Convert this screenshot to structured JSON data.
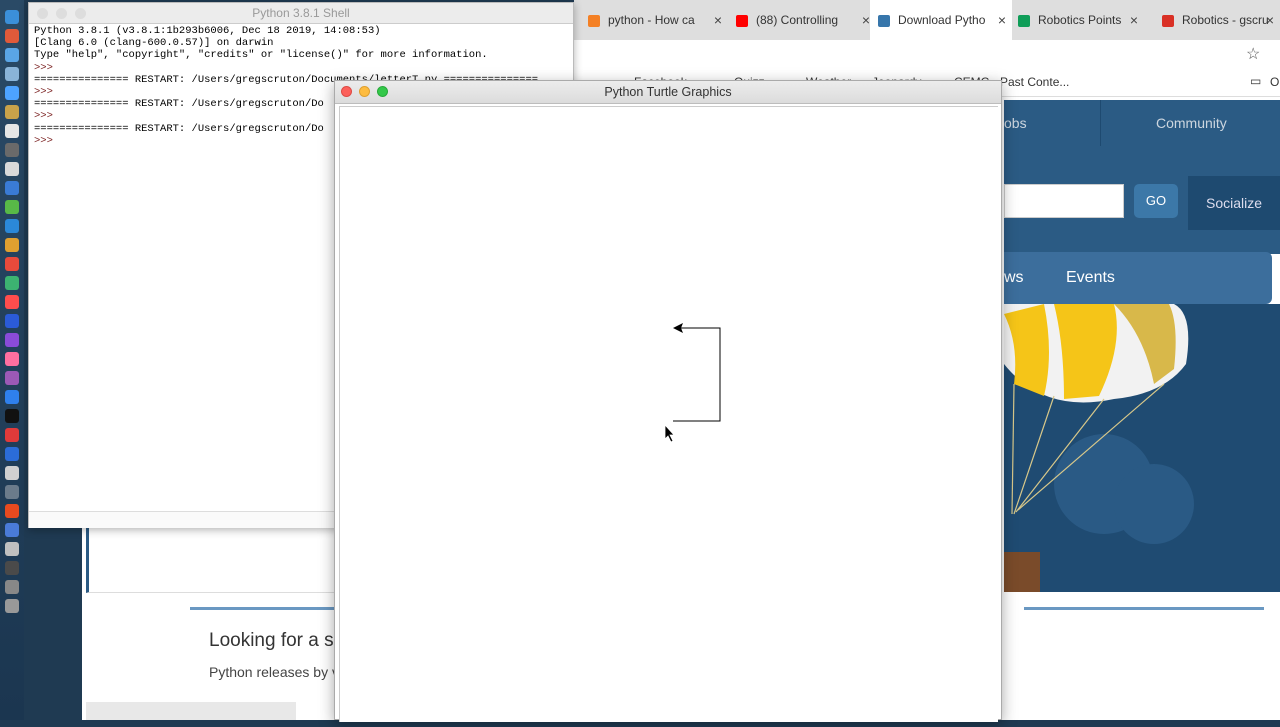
{
  "browser": {
    "tabs": [
      {
        "label": "python - How ca",
        "favicon_color": "#f48024"
      },
      {
        "label": "(88) Controlling",
        "favicon_color": "#ff0000"
      },
      {
        "label": "Download Pytho",
        "favicon_color": "#3776ab",
        "active": true
      },
      {
        "label": "Robotics Points",
        "favicon_color": "#0f9d58"
      },
      {
        "label": "Robotics - gscru",
        "favicon_color": "#d93025"
      }
    ],
    "bookmarks": [
      "Facebook",
      "Quizz",
      "Weather",
      "Jeopardy",
      "CEMC - Past Conte...",
      "O"
    ],
    "nav": {
      "jobs": "obs",
      "community": "Community"
    },
    "search": {
      "go": "GO",
      "socialize": "Socialize"
    },
    "subnav": {
      "news": "ws",
      "events": "Events"
    },
    "page": {
      "looking": "Looking for a s",
      "releases": "Python releases by v"
    }
  },
  "shell": {
    "title": "Python 3.8.1 Shell",
    "lines": [
      "Python 3.8.1 (v3.8.1:1b293b6006, Dec 18 2019, 14:08:53)",
      "[Clang 6.0 (clang-600.0.57)] on darwin",
      "Type \"help\", \"copyright\", \"credits\" or \"license()\" for more information."
    ],
    "prompt": ">>>",
    "restart_1": "=============== RESTART: /Users/gregscruton/Documents/letterT.py ===============",
    "restart_2": "=============== RESTART: /Users/gregscruton/Do",
    "restart_3": "=============== RESTART: /Users/gregscruton/Do"
  },
  "turtle": {
    "title": "Python Turtle Graphics"
  },
  "colors": {
    "python_blue": "#2b5b84",
    "traffic_red": "#fc605b",
    "traffic_yellow": "#fdbc40",
    "traffic_green": "#34c84a"
  }
}
